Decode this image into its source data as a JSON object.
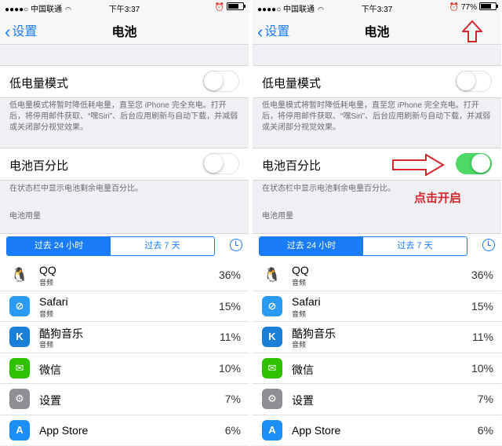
{
  "status_bar": {
    "carrier": "中国联通",
    "time": "下午3:37",
    "battery_percent": "77%"
  },
  "navbar": {
    "back_label": "设置",
    "title": "电池"
  },
  "low_power": {
    "label": "低电量模式",
    "footnote": "低电量模式将暂时降低耗电量，直至您 iPhone 完全充电。打开后，将停用邮件获取、“嘿Siri”、后台应用刷新与自动下载，并减弱或关闭部分视觉效果。"
  },
  "battery_percentage": {
    "label": "电池百分比",
    "footnote": "在状态栏中显示电池剩余电量百分比。",
    "left_on": false,
    "right_on": true
  },
  "usage": {
    "header": "电池用量",
    "segments": [
      "过去 24 小时",
      "过去 7 天"
    ],
    "active_segment": 0
  },
  "apps": [
    {
      "name": "QQ",
      "sub": "音频",
      "percent": "36%",
      "icon": "qq-penguin-icon",
      "glyph": "🐧",
      "color": "#ffffff"
    },
    {
      "name": "Safari",
      "sub": "音频",
      "percent": "15%",
      "icon": "safari-compass-icon",
      "glyph": "⊘",
      "color": "#2a9bf5"
    },
    {
      "name": "酷狗音乐",
      "sub": "音频",
      "percent": "11%",
      "icon": "kugou-icon",
      "glyph": "K",
      "color": "#1a7fd6"
    },
    {
      "name": "微信",
      "sub": "",
      "percent": "10%",
      "icon": "wechat-icon",
      "glyph": "✉",
      "color": "#2dc100"
    },
    {
      "name": "设置",
      "sub": "",
      "percent": "7%",
      "icon": "settings-gear-icon",
      "glyph": "⚙",
      "color": "#8e8e93"
    },
    {
      "name": "App Store",
      "sub": "",
      "percent": "6%",
      "icon": "appstore-icon",
      "glyph": "A",
      "color": "#1c8ef5"
    }
  ],
  "annotation": {
    "text": "点击开启",
    "color": "#d4262b"
  },
  "accent_color": "#1a7cf9",
  "toggle_on_color": "#4cd964"
}
